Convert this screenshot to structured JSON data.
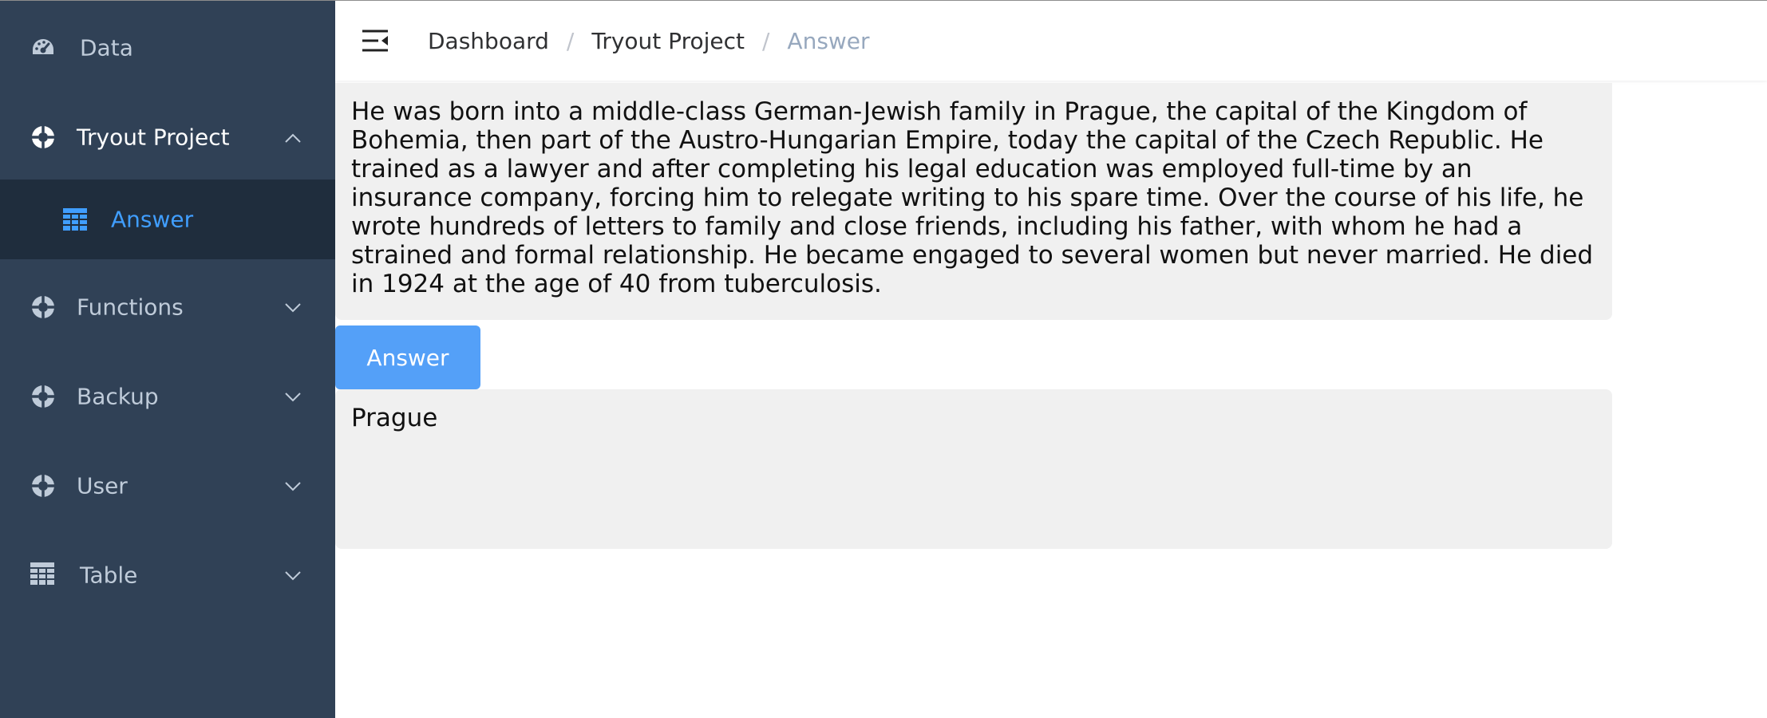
{
  "sidebar": {
    "items": [
      {
        "label": "Data",
        "icon": "dashboard-gauge-icon",
        "expanded": false
      },
      {
        "label": "Tryout Project",
        "icon": "lifebuoy-icon",
        "expanded": true,
        "children": [
          {
            "label": "Answer",
            "icon": "table-grid-icon",
            "active": true
          }
        ]
      },
      {
        "label": "Functions",
        "icon": "lifebuoy-icon",
        "expanded": false
      },
      {
        "label": "Backup",
        "icon": "lifebuoy-icon",
        "expanded": false
      },
      {
        "label": "User",
        "icon": "lifebuoy-icon",
        "expanded": false
      },
      {
        "label": "Table",
        "icon": "table-grid-icon",
        "expanded": false
      }
    ],
    "colors": {
      "background": "#304156",
      "submenu_background": "#1f2d3d",
      "text": "#bfcbd9",
      "active": "#409eff"
    }
  },
  "header": {
    "breadcrumb": [
      "Dashboard",
      "Tryout Project",
      "Answer"
    ]
  },
  "main": {
    "question_text": "He was born into a middle-class German-Jewish family in Prague, the capital of the Kingdom of Bohemia, then part of the Austro-Hungarian Empire, today the capital of the Czech Republic. He trained as a lawyer and after completing his legal education was employed full-time by an insurance company, forcing him to relegate writing to his spare time. Over the course of his life, he wrote hundreds of letters to family and close friends, including his father, with whom he had a strained and formal relationship. He became engaged to several women but never married. He died in 1924 at the age of 40 from tuberculosis.",
    "answer_button_label": "Answer",
    "answer_text": "Prague",
    "colors": {
      "button": "#54a0f8",
      "panel": "#f0f0f0"
    }
  }
}
